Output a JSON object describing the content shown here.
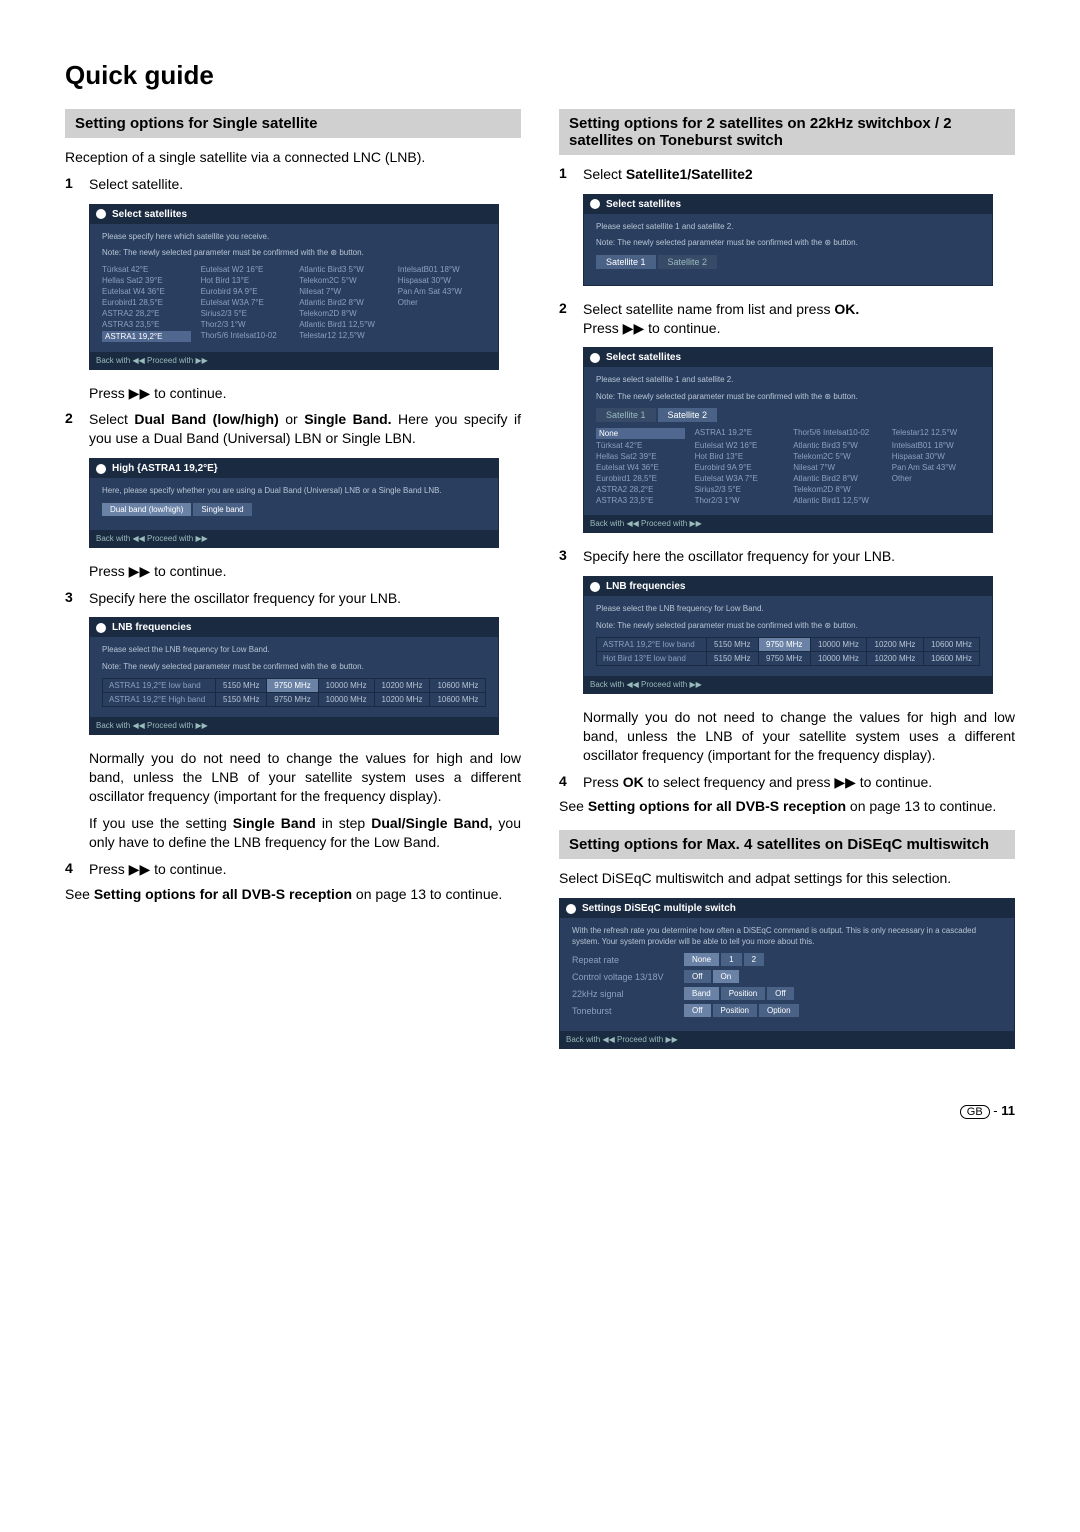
{
  "pageTitle": "Quick guide",
  "left": {
    "heading1": "Setting options for Single satellite",
    "p1": "Reception of a single satellite via a connected LNC (LNB).",
    "step1": "Select satellite.",
    "dialog1": {
      "title": "Select satellites",
      "note1": "Please specify here which satellite you receive.",
      "note2": "Note: The newly selected parameter must be confirmed with the ⊛ button.",
      "cells": [
        "Türksat 42°E",
        "Eutelsat W2 16°E",
        "Atlantic Bird3 5°W",
        "IntelsatB01 18°W",
        "Hellas Sat2 39°E",
        "Hot Bird 13°E",
        "Telekom2C 5°W",
        "Hispasat 30°W",
        "Eutelsat W4 36°E",
        "Eurobird 9A 9°E",
        "Nilesat 7°W",
        "Pan Am Sat 43°W",
        "Eurobird1 28,5°E",
        "Eutelsat W3A 7°E",
        "Atlantic Bird2 8°W",
        "Other",
        "ASTRA2 28,2°E",
        "Sirius2/3 5°E",
        "Telekom2D 8°W",
        "",
        "ASTRA3 23,5°E",
        "Thor2/3 1°W",
        "Atlantic Bird1 12,5°W",
        "",
        "ASTRA1 19,2°E",
        "Thor5/6 Intelsat10-02",
        "Telestar12 12,5°W",
        ""
      ],
      "footer": "Back with ◀◀    Proceed with ▶▶"
    },
    "afterD1": "Press ▶▶ to continue.",
    "step2a": "Select ",
    "step2b": "Dual Band (low/high)",
    "step2c": " or ",
    "step2d": "Single Band.",
    "step2rest": " Here you specify if you use a Dual Band (Universal) LBN or Single LBN.",
    "dialog2": {
      "title": "High {ASTRA1 19,2°E}",
      "note": "Here, please specify whether you are using a Dual Band (Universal) LNB or a Single Band LNB.",
      "opt1": "Dual band (low/high)",
      "opt2": "Single band",
      "footer": "Back with ◀◀    Proceed with ▶▶"
    },
    "afterD2": "Press ▶▶ to continue.",
    "step3": "Specify here the oscillator frequency for your LNB.",
    "dialog3": {
      "title": "LNB frequencies",
      "note1": "Please select the LNB frequency for Low Band.",
      "note2": "Note: The newly selected parameter must be confirmed with the ⊛ button.",
      "row1Label": "ASTRA1 19,2°E low band",
      "row2Label": "ASTRA1 19,2°E High band",
      "freqs": [
        "5150 MHz",
        "9750 MHz",
        "10000 MHz",
        "10200 MHz",
        "10600 MHz"
      ],
      "footer": "Back with ◀◀    Proceed with ▶▶"
    },
    "afterD3a": "Normally you do not need to change the values for high and low band, unless the LNB of your satellite system uses a different oscillator frequency (important for the frequency display).",
    "afterD3b_a": "If you use the setting ",
    "afterD3b_b": "Single Band",
    "afterD3b_c": " in step ",
    "afterD3b_d": "Dual/Single Band,",
    "afterD3b_e": " you only have to define the LNB frequency for the Low Band.",
    "step4": "Press ▶▶ to continue.",
    "see1a": "See ",
    "see1b": "Setting options for all DVB-S reception",
    "see1c": " on page 13 to continue."
  },
  "right": {
    "heading1": "Setting options for 2 satellites on 22kHz switchbox / 2 satellites on Toneburst switch",
    "step1a": "Select ",
    "step1b": "Satellite1/Satellite2",
    "dialogR1": {
      "title": "Select satellites",
      "note1": "Please select satellite 1 and satellite 2.",
      "note2": "Note: The newly selected parameter must be confirmed with the ⊛ button.",
      "tab1": "Satellite 1",
      "tab2": "Satellite 2"
    },
    "step2a": "Select satellite name from list and press ",
    "step2b": "OK.",
    "step2c": "Press ▶▶ to continue.",
    "dialogR2": {
      "title": "Select satellites",
      "note1": "Please select satellite 1 and satellite 2.",
      "note2": "Note: The newly selected parameter must be confirmed with the ⊛ button.",
      "tab1": "Satellite 1",
      "tab2": "Satellite 2",
      "cells": [
        "None",
        "ASTRA1 19,2°E",
        "Thor5/6 Intelsat10-02",
        "Telestar12 12,5°W",
        "Türksat 42°E",
        "Eutelsat W2 16°E",
        "Atlantic Bird3 5°W",
        "IntelsatB01 18°W",
        "Hellas Sat2 39°E",
        "Hot Bird 13°E",
        "Telekom2C 5°W",
        "Hispasat 30°W",
        "Eutelsat W4 36°E",
        "Eurobird 9A 9°E",
        "Nilesat 7°W",
        "Pan Am Sat 43°W",
        "Eurobird1 28,5°E",
        "Eutelsat W3A 7°E",
        "Atlantic Bird2 8°W",
        "Other",
        "ASTRA2 28,2°E",
        "Sirius2/3 5°E",
        "Telekom2D 8°W",
        "",
        "ASTRA3 23,5°E",
        "Thor2/3 1°W",
        "Atlantic Bird1 12,5°W",
        ""
      ],
      "footer": "Back with ◀◀    Proceed with ▶▶"
    },
    "step3": "Specify here the oscillator frequency for your LNB.",
    "dialogR3": {
      "title": "LNB frequencies",
      "note1": "Please select the LNB frequency for Low Band.",
      "note2": "Note: The newly selected parameter must be confirmed with the ⊛ button.",
      "row1Label": "ASTRA1 19,2°E low band",
      "row2Label": "Hot Bird 13°E low band",
      "freqs": [
        "5150 MHz",
        "9750 MHz",
        "10000 MHz",
        "10200 MHz",
        "10600 MHz"
      ],
      "footer": "Back with ◀◀    Proceed with ▶▶"
    },
    "afterR3": "Normally you do not need to change the values for high and low band, unless the LNB of your satellite system uses a different oscillator frequency (important for the frequency display).",
    "step4a": "Press ",
    "step4b": "OK",
    "step4c": " to select frequency and press ▶▶ to continue.",
    "see1a": "See ",
    "see1b": "Setting options for all DVB-S reception",
    "see1c": " on page 13 to continue.",
    "heading2": "Setting options for Max. 4 satellites on DiSEqC multiswitch",
    "p2": "Select DiSEqC multiswitch and adpat settings for this selection.",
    "dialogR4": {
      "title": "Settings DiSEqC multiple switch",
      "note": "With the refresh rate you determine how often a DiSEqC command is output. This is only necessary in a cascaded system. Your system provider will be able to tell you more about this.",
      "row1": "Repeat rate",
      "r1opts": [
        "None",
        "1",
        "2"
      ],
      "row2": "Control voltage 13/18V",
      "r2opts": [
        "Off",
        "On"
      ],
      "row3": "22kHz signal",
      "r3opts": [
        "Band",
        "Position",
        "Off"
      ],
      "row4": "Toneburst",
      "r4opts": [
        "Off",
        "Position",
        "Option"
      ],
      "footer": "Back with ◀◀    Proceed with ▶▶"
    }
  },
  "footer": {
    "gb": "GB",
    "sep": " - ",
    "page": "11"
  }
}
